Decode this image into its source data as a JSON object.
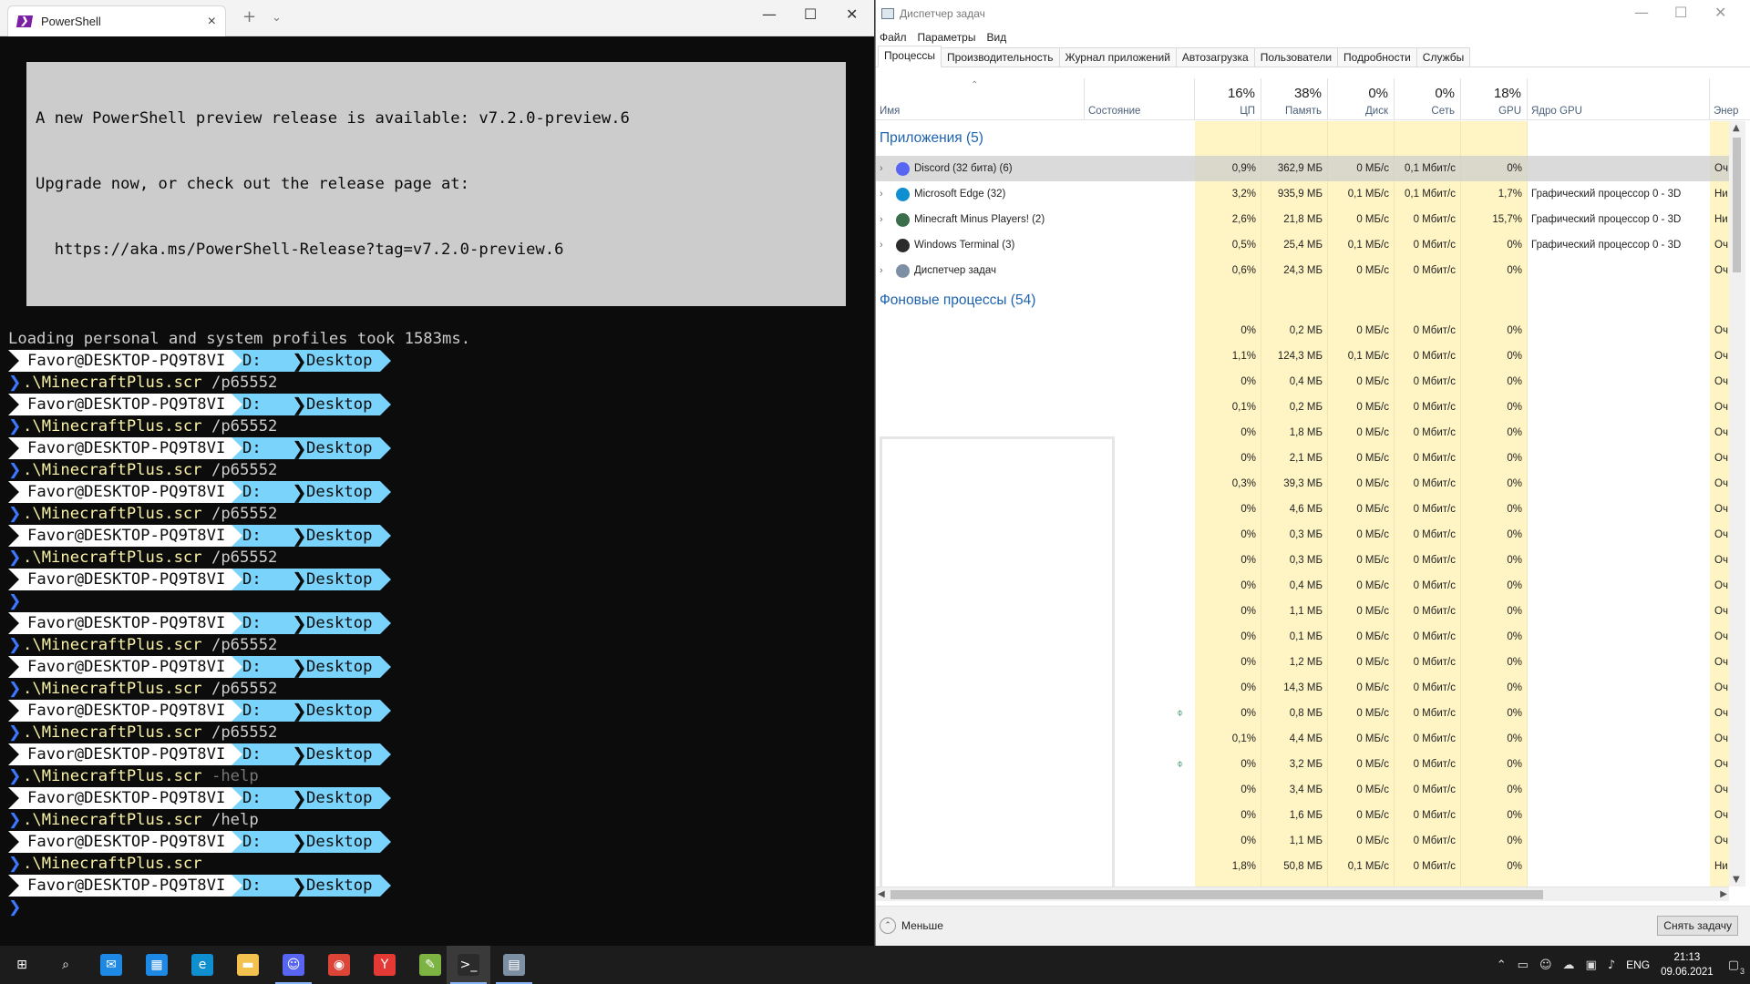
{
  "terminal": {
    "tab_title": "PowerShell",
    "notice": [
      "A new PowerShell preview release is available: v7.2.0-preview.6",
      "Upgrade now, or check out the release page at:",
      "  https://aka.ms/PowerShell-Release?tag=v7.2.0-preview.6"
    ],
    "loading": "Loading personal and system profiles took 1583ms.",
    "prompt_user": "Favor@DESKTOP-PQ9T8VI",
    "prompt_drive": "D:",
    "prompt_dir": "Desktop",
    "caret": "❯",
    "commands": [
      {
        "cmd": ".\\MinecraftPlus.scr",
        "arg": "/p65552",
        "dim": false
      },
      {
        "cmd": ".\\MinecraftPlus.scr",
        "arg": "/p65552",
        "dim": false
      },
      {
        "cmd": ".\\MinecraftPlus.scr",
        "arg": "/p65552",
        "dim": false
      },
      {
        "cmd": ".\\MinecraftPlus.scr",
        "arg": "/p65552",
        "dim": false
      },
      {
        "cmd": ".\\MinecraftPlus.scr",
        "arg": "/p65552",
        "dim": false
      },
      {
        "cmd": "",
        "arg": "",
        "dim": false
      },
      {
        "cmd": ".\\MinecraftPlus.scr",
        "arg": "/p65552",
        "dim": false
      },
      {
        "cmd": ".\\MinecraftPlus.scr",
        "arg": "/p65552",
        "dim": false
      },
      {
        "cmd": ".\\MinecraftPlus.scr",
        "arg": "/p65552",
        "dim": false
      },
      {
        "cmd": ".\\MinecraftPlus.scr",
        "arg": "-help",
        "dim": true
      },
      {
        "cmd": ".\\MinecraftPlus.scr",
        "arg": "/help",
        "dim": false
      },
      {
        "cmd": ".\\MinecraftPlus.scr",
        "arg": "",
        "dim": false
      }
    ]
  },
  "taskmgr": {
    "title": "Диспетчер задач",
    "menu": [
      "Файл",
      "Параметры",
      "Вид"
    ],
    "tabs": [
      "Процессы",
      "Производительность",
      "Журнал приложений",
      "Автозагрузка",
      "Пользователи",
      "Подробности",
      "Службы"
    ],
    "header": {
      "name": "Имя",
      "status": "Состояние",
      "cpu_pct": "16%",
      "cpu": "ЦП",
      "mem_pct": "38%",
      "mem": "Память",
      "disk_pct": "0%",
      "disk": "Диск",
      "net_pct": "0%",
      "net": "Сеть",
      "gpu_pct": "18%",
      "gpu": "GPU",
      "gpu_engine": "Ядро GPU",
      "energy": "Энер"
    },
    "apps_group": "Приложения (5)",
    "bg_group": "Фоновые процессы (54)",
    "apps": [
      {
        "name": "Discord (32 бита) (6)",
        "cpu": "0,9%",
        "mem": "362,9 МБ",
        "disk": "0 МБ/с",
        "net": "0,1 Мбит/с",
        "gpu": "0%",
        "gpue": "",
        "en": "Оч",
        "icon": "discord",
        "color": "#5865f2"
      },
      {
        "name": "Microsoft Edge (32)",
        "cpu": "3,2%",
        "mem": "935,9 МБ",
        "disk": "0,1 МБ/с",
        "net": "0,1 Мбит/с",
        "gpu": "1,7%",
        "gpue": "Графический процессор 0 - 3D",
        "en": "Ни",
        "icon": "edge",
        "color": "#0f8fcf"
      },
      {
        "name": "Minecraft Minus Players! (2)",
        "cpu": "2,6%",
        "mem": "21,8 МБ",
        "disk": "0 МБ/с",
        "net": "0 Мбит/с",
        "gpu": "15,7%",
        "gpue": "Графический процессор 0 - 3D",
        "en": "Ни",
        "icon": "minecraft",
        "color": "#3b6e4a"
      },
      {
        "name": "Windows Terminal (3)",
        "cpu": "0,5%",
        "mem": "25,4 МБ",
        "disk": "0,1 МБ/с",
        "net": "0 Мбит/с",
        "gpu": "0%",
        "gpue": "Графический процессор 0 - 3D",
        "en": "Оч",
        "icon": "terminal",
        "color": "#2b2b2b"
      },
      {
        "name": "Диспетчер задач",
        "cpu": "0,6%",
        "mem": "24,3 МБ",
        "disk": "0 МБ/с",
        "net": "0 Мбит/с",
        "gpu": "0%",
        "gpue": "",
        "en": "Оч",
        "icon": "taskmgr",
        "color": "#7d8fa3"
      }
    ],
    "bg": [
      {
        "cpu": "0%",
        "mem": "0,2 МБ",
        "disk": "0 МБ/с",
        "net": "0 Мбит/с",
        "gpu": "0%",
        "en": "Оч",
        "leaf": false
      },
      {
        "cpu": "1,1%",
        "mem": "124,3 МБ",
        "disk": "0,1 МБ/с",
        "net": "0 Мбит/с",
        "gpu": "0%",
        "en": "Оч",
        "leaf": false
      },
      {
        "cpu": "0%",
        "mem": "0,4 МБ",
        "disk": "0 МБ/с",
        "net": "0 Мбит/с",
        "gpu": "0%",
        "en": "Оч",
        "leaf": false
      },
      {
        "cpu": "0,1%",
        "mem": "0,2 МБ",
        "disk": "0 МБ/с",
        "net": "0 Мбит/с",
        "gpu": "0%",
        "en": "Оч",
        "leaf": false
      },
      {
        "cpu": "0%",
        "mem": "1,8 МБ",
        "disk": "0 МБ/с",
        "net": "0 Мбит/с",
        "gpu": "0%",
        "en": "Оч",
        "leaf": false
      },
      {
        "cpu": "0%",
        "mem": "2,1 МБ",
        "disk": "0 МБ/с",
        "net": "0 Мбит/с",
        "gpu": "0%",
        "en": "Оч",
        "leaf": false
      },
      {
        "cpu": "0,3%",
        "mem": "39,3 МБ",
        "disk": "0 МБ/с",
        "net": "0 Мбит/с",
        "gpu": "0%",
        "en": "Оч",
        "leaf": false
      },
      {
        "cpu": "0%",
        "mem": "4,6 МБ",
        "disk": "0 МБ/с",
        "net": "0 Мбит/с",
        "gpu": "0%",
        "en": "Оч",
        "leaf": false
      },
      {
        "cpu": "0%",
        "mem": "0,3 МБ",
        "disk": "0 МБ/с",
        "net": "0 Мбит/с",
        "gpu": "0%",
        "en": "Оч",
        "leaf": false
      },
      {
        "cpu": "0%",
        "mem": "0,3 МБ",
        "disk": "0 МБ/с",
        "net": "0 Мбит/с",
        "gpu": "0%",
        "en": "Оч",
        "leaf": false
      },
      {
        "cpu": "0%",
        "mem": "0,4 МБ",
        "disk": "0 МБ/с",
        "net": "0 Мбит/с",
        "gpu": "0%",
        "en": "Оч",
        "leaf": false
      },
      {
        "cpu": "0%",
        "mem": "1,1 МБ",
        "disk": "0 МБ/с",
        "net": "0 Мбит/с",
        "gpu": "0%",
        "en": "Оч",
        "leaf": false
      },
      {
        "cpu": "0%",
        "mem": "0,1 МБ",
        "disk": "0 МБ/с",
        "net": "0 Мбит/с",
        "gpu": "0%",
        "en": "Оч",
        "leaf": false
      },
      {
        "cpu": "0%",
        "mem": "1,2 МБ",
        "disk": "0 МБ/с",
        "net": "0 Мбит/с",
        "gpu": "0%",
        "en": "Оч",
        "leaf": false
      },
      {
        "cpu": "0%",
        "mem": "14,3 МБ",
        "disk": "0 МБ/с",
        "net": "0 Мбит/с",
        "gpu": "0%",
        "en": "Оч",
        "leaf": false
      },
      {
        "cpu": "0%",
        "mem": "0,8 МБ",
        "disk": "0 МБ/с",
        "net": "0 Мбит/с",
        "gpu": "0%",
        "en": "Оч",
        "leaf": true
      },
      {
        "cpu": "0,1%",
        "mem": "4,4 МБ",
        "disk": "0 МБ/с",
        "net": "0 Мбит/с",
        "gpu": "0%",
        "en": "Оч",
        "leaf": false
      },
      {
        "cpu": "0%",
        "mem": "3,2 МБ",
        "disk": "0 МБ/с",
        "net": "0 Мбит/с",
        "gpu": "0%",
        "en": "Оч",
        "leaf": true
      },
      {
        "cpu": "0%",
        "mem": "3,4 МБ",
        "disk": "0 МБ/с",
        "net": "0 Мбит/с",
        "gpu": "0%",
        "en": "Оч",
        "leaf": false
      },
      {
        "cpu": "0%",
        "mem": "1,6 МБ",
        "disk": "0 МБ/с",
        "net": "0 Мбит/с",
        "gpu": "0%",
        "en": "Оч",
        "leaf": false
      },
      {
        "cpu": "0%",
        "mem": "1,1 МБ",
        "disk": "0 МБ/с",
        "net": "0 Мбит/с",
        "gpu": "0%",
        "en": "Оч",
        "leaf": false
      },
      {
        "cpu": "1,8%",
        "mem": "50,8 МБ",
        "disk": "0,1 МБ/с",
        "net": "0 Мбит/с",
        "gpu": "0%",
        "en": "Ни",
        "leaf": false
      }
    ],
    "fewer_label": "Меньше",
    "end_task_label": "Снять задачу"
  },
  "taskbar": {
    "apps": [
      {
        "name": "start",
        "icon": "windows-icon",
        "glyph": "⊞",
        "color": "#ffffff"
      },
      {
        "name": "search",
        "icon": "search-icon",
        "glyph": "⌕",
        "color": "#ffffff"
      },
      {
        "name": "mail",
        "icon": "mail-icon",
        "glyph": "✉",
        "color": "#1e88e5"
      },
      {
        "name": "store",
        "icon": "store-icon",
        "glyph": "▦",
        "color": "#1e88e5"
      },
      {
        "name": "edge",
        "icon": "edge-icon",
        "glyph": "e",
        "color": "#0f8fcf"
      },
      {
        "name": "explorer",
        "icon": "folder-icon",
        "glyph": "▬",
        "color": "#f2c14e"
      },
      {
        "name": "discord",
        "icon": "discord-icon",
        "glyph": "☺",
        "color": "#5865f2"
      },
      {
        "name": "chrome",
        "icon": "chrome-icon",
        "glyph": "◉",
        "color": "#db4437"
      },
      {
        "name": "yandex",
        "icon": "yandex-icon",
        "glyph": "Y",
        "color": "#e53935"
      },
      {
        "name": "notepad",
        "icon": "notepad-icon",
        "glyph": "✎",
        "color": "#7cb342"
      },
      {
        "name": "terminal",
        "icon": "terminal-icon",
        "glyph": ">_",
        "color": "#2b2b2b"
      },
      {
        "name": "taskmgr",
        "icon": "task-manager-icon",
        "glyph": "▤",
        "color": "#7d8fa3"
      }
    ],
    "lang": "ENG",
    "time": "21:13",
    "date": "09.06.2021",
    "notif_count": "3"
  }
}
